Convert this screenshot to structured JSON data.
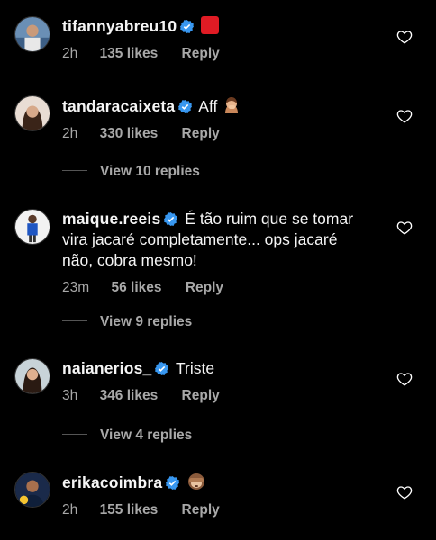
{
  "comments": [
    {
      "username": "tifannyabreu10",
      "text": "",
      "emoji": "red-square",
      "time": "2h",
      "likes": "135 likes",
      "reply": "Reply"
    },
    {
      "username": "tandaracaixeta",
      "text": "Aff",
      "emoji": "facepalm",
      "time": "2h",
      "likes": "330 likes",
      "reply": "Reply",
      "view_replies": "View 10 replies"
    },
    {
      "username": "maique.reeis",
      "text_line1": "É tão ruim que se tomar",
      "text_line2": "vira jacaré completamente... ops jacaré",
      "text_line3": "não, cobra mesmo!",
      "time": "23m",
      "likes": "56 likes",
      "reply": "Reply",
      "view_replies": "View 9 replies"
    },
    {
      "username": "naianerios_",
      "text": "Triste",
      "time": "3h",
      "likes": "346 likes",
      "reply": "Reply",
      "view_replies": "View 4 replies"
    },
    {
      "username": "erikacoimbra",
      "text": "",
      "emoji": "see-no-evil-monkey",
      "time": "2h",
      "likes": "155 likes",
      "reply": "Reply"
    }
  ],
  "colors": {
    "background": "#000000",
    "text": "#f5f5f5",
    "secondary": "#a8a8a8",
    "verified": "#3897f0"
  }
}
